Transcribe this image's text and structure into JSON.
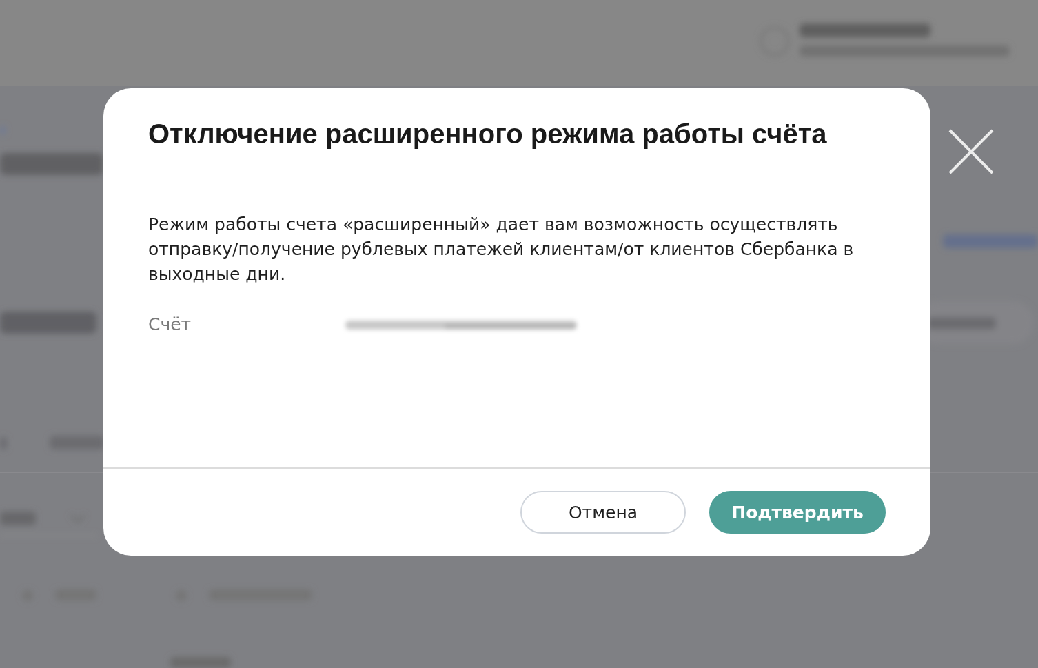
{
  "dialog": {
    "title": "Отключение расширенного режима работы счёта",
    "description": "Режим работы счета «расширенный» дает вам возможность осуществлять отправку/получение рублевых платежей клиентам/от клиентов Сбербанка в выходные дни.",
    "fields": [
      {
        "label": "Счёт",
        "redacted": true
      }
    ],
    "buttons": [
      {
        "label": "Отмена",
        "kind": "secondary"
      },
      {
        "label": "Подтвердить",
        "kind": "primary"
      }
    ]
  }
}
